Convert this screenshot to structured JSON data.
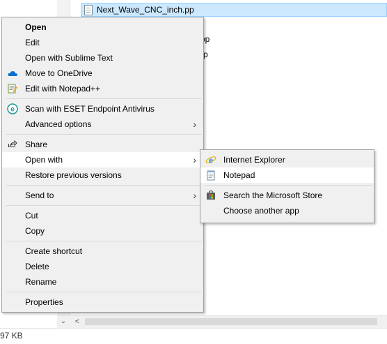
{
  "explorer": {
    "selected_file": "Next_Wave_CNC_inch.pp",
    "partial_files": [
      "ch.pp",
      "m.pp"
    ],
    "status_size": "97 KB"
  },
  "context_menu": {
    "open": "Open",
    "edit": "Edit",
    "open_sublime": "Open with Sublime Text",
    "move_onedrive": "Move to OneDrive",
    "edit_notepadpp": "Edit with Notepad++",
    "scan_eset": "Scan with ESET Endpoint Antivirus",
    "advanced_options": "Advanced options",
    "share": "Share",
    "open_with": "Open with",
    "restore_versions": "Restore previous versions",
    "send_to": "Send to",
    "cut": "Cut",
    "copy": "Copy",
    "create_shortcut": "Create shortcut",
    "delete": "Delete",
    "rename": "Rename",
    "properties": "Properties"
  },
  "open_with_menu": {
    "internet_explorer": "Internet Explorer",
    "notepad": "Notepad",
    "search_store": "Search the Microsoft Store",
    "choose_app": "Choose another app"
  },
  "icons": {
    "onedrive": "cloud-icon",
    "notepadpp": "notepad-plus-plus-icon",
    "eset": "eset-icon",
    "share": "share-icon",
    "ie": "internet-explorer-icon",
    "notepad": "notepad-icon",
    "store": "store-icon",
    "submenu": "chevron-right-icon"
  },
  "colors": {
    "menu_bg": "#f0f0f0",
    "selection": "#cce8ff",
    "onedrive_blue": "#0f6fd1",
    "eset_teal": "#1b9a9a"
  }
}
